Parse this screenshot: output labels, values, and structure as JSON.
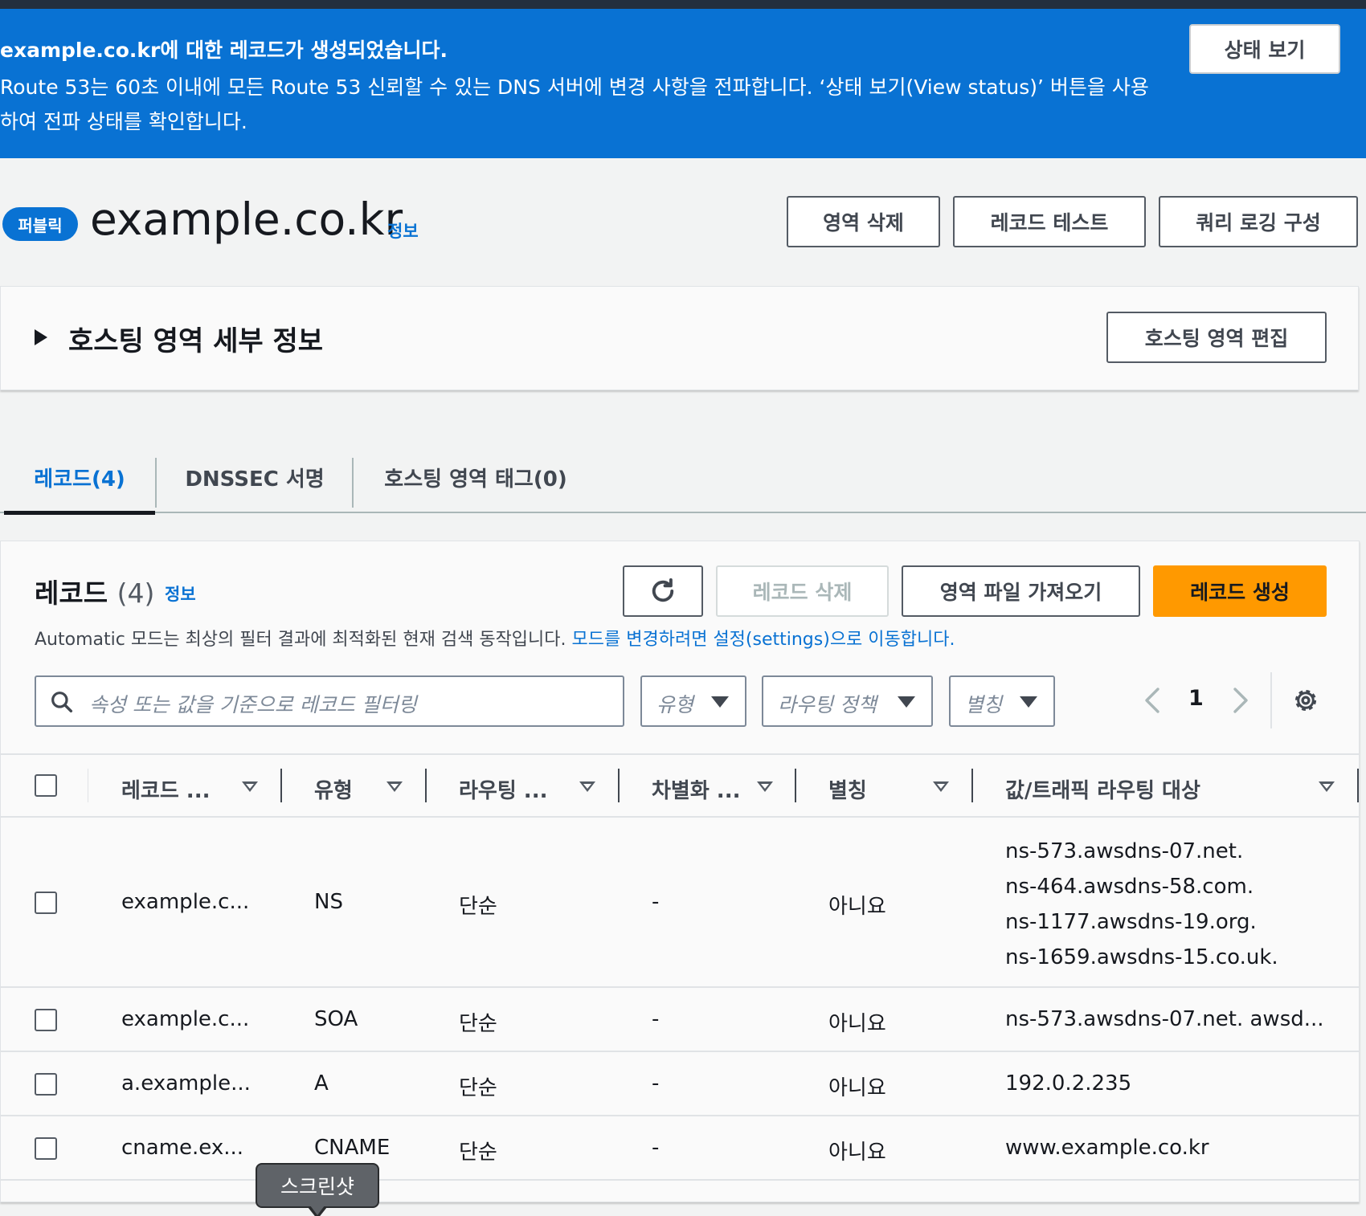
{
  "flash": {
    "title": "example.co.kr에 대한 레코드가 생성되었습니다.",
    "body": "Route 53는 60초 이내에 모든 Route 53 신뢰할 수 있는 DNS 서버에 변경 사항을 전파합니다. ‘상태 보기(View status)’ 버튼을 사용하여 전파 상태를 확인합니다.",
    "button": "상태 보기"
  },
  "zone": {
    "badge": "퍼블릭",
    "name": "example.co.kr",
    "info": "정보",
    "actions": {
      "delete": "영역 삭제",
      "test": "레코드 테스트",
      "logging": "쿼리 로깅 구성"
    }
  },
  "details": {
    "title": "호스팅 영역 세부 정보",
    "edit": "호스팅 영역 편집"
  },
  "tabs": [
    {
      "label": "레코드(4)",
      "active": true
    },
    {
      "label": "DNSSEC 서명",
      "active": false
    },
    {
      "label": "호스팅 영역 태그(0)",
      "active": false
    }
  ],
  "records": {
    "title": "레코드",
    "count": "(4)",
    "info": "정보",
    "delete": "레코드 삭제",
    "import": "영역 파일 가져오기",
    "create": "레코드 생성",
    "description": "Automatic 모드는 최상의 필터 결과에 최적화된 현재 검색 동작입니다.",
    "description_link": "모드를 변경하려면 설정(settings)으로 이동합니다.",
    "search_placeholder": "속성 또는 값을 기준으로 레코드 필터링",
    "filters": {
      "type": "유형",
      "routing": "라우팅 정책",
      "alias": "별칭"
    },
    "page": "1",
    "columns": [
      "레코드 ...",
      "유형",
      "라우팅 ...",
      "차별화 ...",
      "별칭",
      "값/트래픽 라우팅 대상"
    ],
    "rows": [
      {
        "name": "example.c...",
        "type": "NS",
        "routing": "단순",
        "diff": "-",
        "alias": "아니요",
        "values": [
          "ns-573.awsdns-07.net.",
          "ns-464.awsdns-58.com.",
          "ns-1177.awsdns-19.org.",
          "ns-1659.awsdns-15.co.uk."
        ]
      },
      {
        "name": "example.c...",
        "type": "SOA",
        "routing": "단순",
        "diff": "-",
        "alias": "아니요",
        "values": [
          "ns-573.awsdns-07.net. awsd..."
        ]
      },
      {
        "name": "a.example...",
        "type": "A",
        "routing": "단순",
        "diff": "-",
        "alias": "아니요",
        "values": [
          "192.0.2.235"
        ]
      },
      {
        "name": "cname.ex...",
        "type": "CNAME",
        "routing": "단순",
        "diff": "-",
        "alias": "아니요",
        "values": [
          "www.example.co.kr"
        ]
      }
    ]
  },
  "tooltip": "스크린샷",
  "colors": {
    "accent": "#0972d3",
    "primary_button": "#ff9900",
    "navbar": "#232f3e"
  }
}
